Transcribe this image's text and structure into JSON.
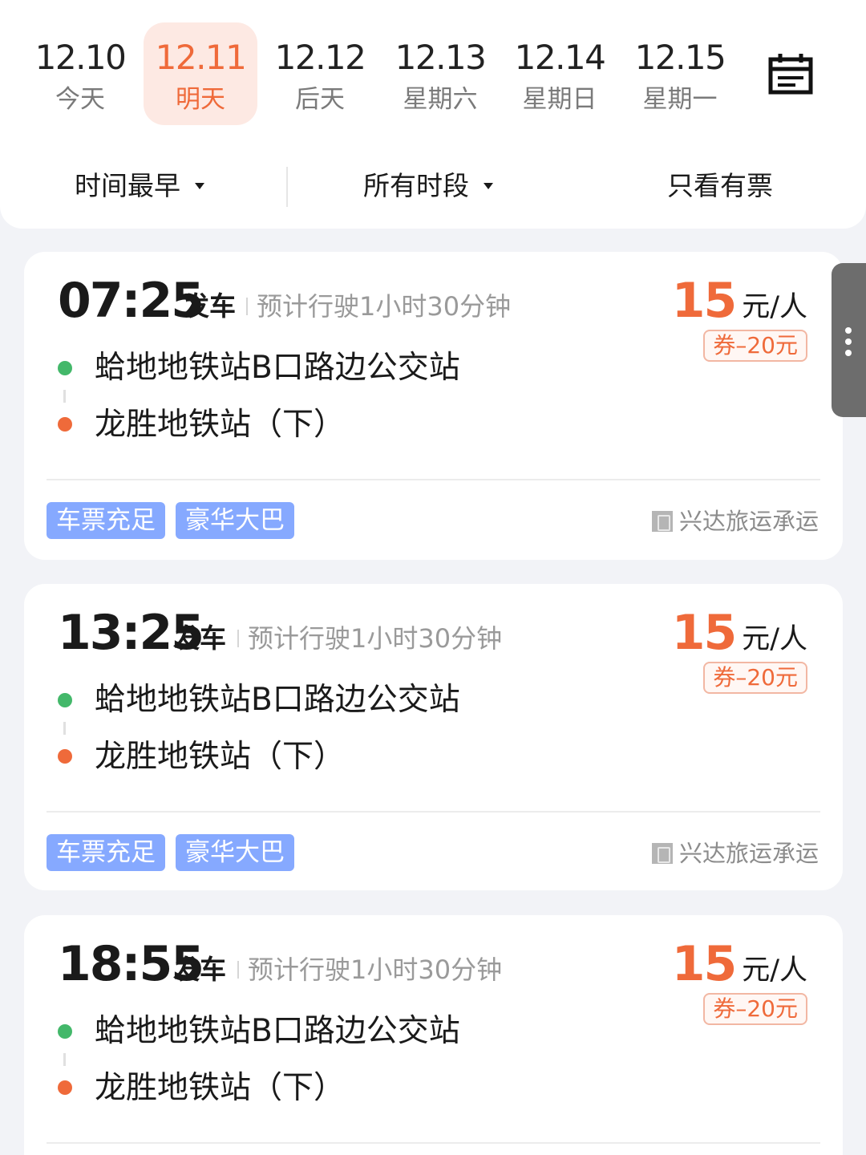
{
  "dates": [
    {
      "date": "12.10",
      "label": "今天",
      "active": false
    },
    {
      "date": "12.11",
      "label": "明天",
      "active": true
    },
    {
      "date": "12.12",
      "label": "后天",
      "active": false
    },
    {
      "date": "12.13",
      "label": "星期六",
      "active": false
    },
    {
      "date": "12.14",
      "label": "星期日",
      "active": false
    },
    {
      "date": "12.15",
      "label": "星期一",
      "active": false
    }
  ],
  "filters": {
    "sort": "时间最早",
    "period": "所有时段",
    "available_only": "只看有票"
  },
  "trips": [
    {
      "time": "07:25",
      "depart_label": "发车",
      "duration": "预计行驶1小时30分钟",
      "from": "蛤地地铁站B口路边公交站",
      "to": "龙胜地铁站（下）",
      "price": "15",
      "price_unit": "元/人",
      "coupon": "券–20元",
      "tags": [
        "车票充足",
        "豪华大巴"
      ],
      "operator": "兴达旅运承运"
    },
    {
      "time": "13:25",
      "depart_label": "发车",
      "duration": "预计行驶1小时30分钟",
      "from": "蛤地地铁站B口路边公交站",
      "to": "龙胜地铁站（下）",
      "price": "15",
      "price_unit": "元/人",
      "coupon": "券–20元",
      "tags": [
        "车票充足",
        "豪华大巴"
      ],
      "operator": "兴达旅运承运"
    },
    {
      "time": "18:55",
      "depart_label": "发车",
      "duration": "预计行驶1小时30分钟",
      "from": "蛤地地铁站B口路边公交站",
      "to": "龙胜地铁站（下）",
      "price": "15",
      "price_unit": "元/人",
      "coupon": "券–20元",
      "tags": [],
      "operator": ""
    }
  ],
  "icons": {
    "calendar": "calendar-icon",
    "more": "more-vertical-icon",
    "operator": "operator-logo-icon"
  },
  "colors": {
    "accent": "#ef6a3a",
    "active_date_bg": "#fde9e3",
    "tag_bg": "#86a9ff",
    "from_dot": "#43b86a",
    "to_dot": "#ef6a3a"
  }
}
